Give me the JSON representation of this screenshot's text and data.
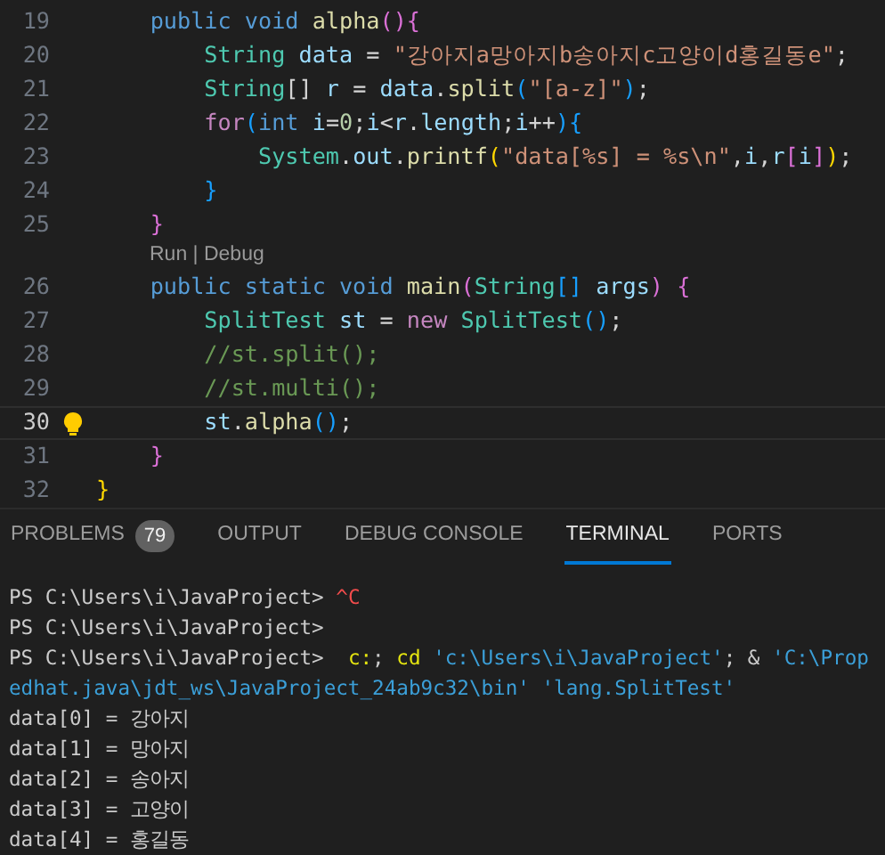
{
  "editor": {
    "lines": [
      {
        "kind": "code",
        "number": "19",
        "current": false,
        "lightbulb": false,
        "tokens": [
          {
            "t": "    public void ",
            "kind": "kw"
          },
          {
            "t": "alpha",
            "kind": "fn"
          },
          {
            "t": "(){",
            "kind": "b2"
          }
        ]
      },
      {
        "kind": "code",
        "number": "20",
        "current": false,
        "lightbulb": false,
        "tokens": [
          {
            "t": "        String ",
            "kind": "type"
          },
          {
            "t": "data",
            "kind": "var"
          },
          {
            "t": " = ",
            "kind": "txt"
          },
          {
            "t": "\"강아지a망아지b송아지c고양이d홍길동e\"",
            "kind": "str"
          },
          {
            "t": ";",
            "kind": "txt"
          }
        ]
      },
      {
        "kind": "code",
        "number": "21",
        "current": false,
        "lightbulb": false,
        "tokens": [
          {
            "t": "        String",
            "kind": "type"
          },
          {
            "t": "[] ",
            "kind": "txt"
          },
          {
            "t": "r",
            "kind": "var"
          },
          {
            "t": " = ",
            "kind": "txt"
          },
          {
            "t": "data",
            "kind": "var"
          },
          {
            "t": ".",
            "kind": "txt"
          },
          {
            "t": "split",
            "kind": "fn"
          },
          {
            "t": "(",
            "kind": "b3"
          },
          {
            "t": "\"[a-z]\"",
            "kind": "str"
          },
          {
            "t": ")",
            "kind": "b3"
          },
          {
            "t": ";",
            "kind": "txt"
          }
        ]
      },
      {
        "kind": "code",
        "number": "22",
        "current": false,
        "lightbulb": false,
        "tokens": [
          {
            "t": "        for",
            "kind": "ctl"
          },
          {
            "t": "(",
            "kind": "b3"
          },
          {
            "t": "int ",
            "kind": "kw"
          },
          {
            "t": "i",
            "kind": "var"
          },
          {
            "t": "=",
            "kind": "txt"
          },
          {
            "t": "0",
            "kind": "num"
          },
          {
            "t": ";",
            "kind": "txt"
          },
          {
            "t": "i",
            "kind": "var"
          },
          {
            "t": "<",
            "kind": "txt"
          },
          {
            "t": "r",
            "kind": "var"
          },
          {
            "t": ".",
            "kind": "txt"
          },
          {
            "t": "length",
            "kind": "var"
          },
          {
            "t": ";",
            "kind": "txt"
          },
          {
            "t": "i",
            "kind": "var"
          },
          {
            "t": "++",
            "kind": "txt"
          },
          {
            "t": "){",
            "kind": "b3"
          }
        ]
      },
      {
        "kind": "code",
        "number": "23",
        "current": false,
        "lightbulb": false,
        "tokens": [
          {
            "t": "            System",
            "kind": "type"
          },
          {
            "t": ".",
            "kind": "txt"
          },
          {
            "t": "out",
            "kind": "var"
          },
          {
            "t": ".",
            "kind": "txt"
          },
          {
            "t": "printf",
            "kind": "fn"
          },
          {
            "t": "(",
            "kind": "b1"
          },
          {
            "t": "\"data[%s] = %s\\n\"",
            "kind": "str"
          },
          {
            "t": ",",
            "kind": "txt"
          },
          {
            "t": "i",
            "kind": "var"
          },
          {
            "t": ",",
            "kind": "txt"
          },
          {
            "t": "r",
            "kind": "var"
          },
          {
            "t": "[",
            "kind": "b2"
          },
          {
            "t": "i",
            "kind": "var"
          },
          {
            "t": "]",
            "kind": "b2"
          },
          {
            "t": ")",
            "kind": "b1"
          },
          {
            "t": ";",
            "kind": "txt"
          }
        ]
      },
      {
        "kind": "code",
        "number": "24",
        "current": false,
        "lightbulb": false,
        "tokens": [
          {
            "t": "        }",
            "kind": "b3"
          }
        ]
      },
      {
        "kind": "code",
        "number": "25",
        "current": false,
        "lightbulb": false,
        "tokens": [
          {
            "t": "    }",
            "kind": "b2"
          }
        ]
      },
      {
        "kind": "codelens",
        "text": "Run | Debug"
      },
      {
        "kind": "code",
        "number": "26",
        "current": false,
        "lightbulb": false,
        "tokens": [
          {
            "t": "    public static void ",
            "kind": "kw"
          },
          {
            "t": "main",
            "kind": "fn"
          },
          {
            "t": "(",
            "kind": "b2"
          },
          {
            "t": "String",
            "kind": "type"
          },
          {
            "t": "[]",
            "kind": "b3"
          },
          {
            "t": " args",
            "kind": "var"
          },
          {
            "t": ") {",
            "kind": "b2"
          }
        ]
      },
      {
        "kind": "code",
        "number": "27",
        "current": false,
        "lightbulb": false,
        "tokens": [
          {
            "t": "        SplitTest ",
            "kind": "type"
          },
          {
            "t": "st",
            "kind": "var"
          },
          {
            "t": " = ",
            "kind": "txt"
          },
          {
            "t": "new ",
            "kind": "ctl"
          },
          {
            "t": "SplitTest",
            "kind": "type"
          },
          {
            "t": "()",
            "kind": "b3"
          },
          {
            "t": ";",
            "kind": "txt"
          }
        ]
      },
      {
        "kind": "code",
        "number": "28",
        "current": false,
        "lightbulb": false,
        "tokens": [
          {
            "t": "        //st.split();",
            "kind": "com"
          }
        ]
      },
      {
        "kind": "code",
        "number": "29",
        "current": false,
        "lightbulb": false,
        "tokens": [
          {
            "t": "        //st.multi();",
            "kind": "com"
          }
        ]
      },
      {
        "kind": "code",
        "number": "30",
        "current": true,
        "lightbulb": true,
        "tokens": [
          {
            "t": "        st",
            "kind": "var"
          },
          {
            "t": ".",
            "kind": "txt"
          },
          {
            "t": "alpha",
            "kind": "fn"
          },
          {
            "t": "()",
            "kind": "b3"
          },
          {
            "t": ";",
            "kind": "txt"
          }
        ]
      },
      {
        "kind": "code",
        "number": "31",
        "current": false,
        "lightbulb": false,
        "tokens": [
          {
            "t": "    }",
            "kind": "b2"
          }
        ]
      },
      {
        "kind": "code",
        "number": "32",
        "current": false,
        "lightbulb": false,
        "tokens": [
          {
            "t": "}",
            "kind": "b1"
          }
        ]
      }
    ]
  },
  "panel": {
    "tabs": [
      {
        "label": "PROBLEMS",
        "badge": "79",
        "selected": false
      },
      {
        "label": "OUTPUT",
        "selected": false
      },
      {
        "label": "DEBUG CONSOLE",
        "selected": false
      },
      {
        "label": "TERMINAL",
        "selected": true
      },
      {
        "label": "PORTS",
        "selected": false
      }
    ],
    "terminal": [
      [
        {
          "t": "PS C:\\Users\\i\\JavaProject> ",
          "kind": "plain"
        },
        {
          "t": "^C",
          "kind": "err"
        }
      ],
      [
        {
          "t": "PS C:\\Users\\i\\JavaProject>",
          "kind": "plain"
        }
      ],
      [
        {
          "t": "PS C:\\Users\\i\\JavaProject>  ",
          "kind": "plain"
        },
        {
          "t": "c:",
          "kind": "cmd"
        },
        {
          "t": "; ",
          "kind": "plain"
        },
        {
          "t": "cd",
          "kind": "cmd"
        },
        {
          "t": " 'c:\\Users\\i\\JavaProject'",
          "kind": "str"
        },
        {
          "t": "; & ",
          "kind": "plain"
        },
        {
          "t": "'C:\\Prop",
          "kind": "str"
        }
      ],
      [
        {
          "t": "edhat.java\\jdt_ws\\JavaProject_24ab9c32\\bin' 'lang.SplitTest'",
          "kind": "str"
        }
      ],
      [
        {
          "t": "data[0] = 강아지",
          "kind": "plain"
        }
      ],
      [
        {
          "t": "data[1] = 망아지",
          "kind": "plain"
        }
      ],
      [
        {
          "t": "data[2] = 송아지",
          "kind": "plain"
        }
      ],
      [
        {
          "t": "data[3] = 고양이",
          "kind": "plain"
        }
      ],
      [
        {
          "t": "data[4] = 홍길동",
          "kind": "plain"
        }
      ]
    ]
  }
}
